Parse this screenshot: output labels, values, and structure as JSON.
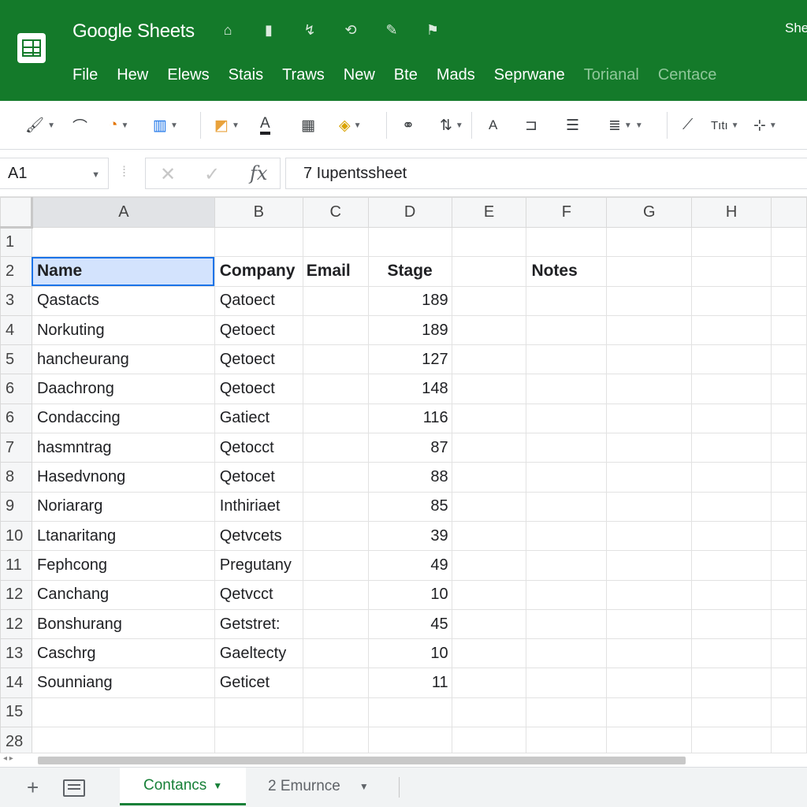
{
  "app": {
    "title": "Google Sheets",
    "share_label": "She"
  },
  "menu": [
    "File",
    "Hew",
    "Elews",
    "Stais",
    "Traws",
    "New",
    "Bte",
    "Mads",
    "Seprwane",
    "Torianal",
    "Centace"
  ],
  "toolbar": {
    "text_button_label": "A",
    "font_size_label": "Tıtı"
  },
  "formula_bar": {
    "cell_ref": "A1",
    "content": "7 Iupentssheet"
  },
  "columns": [
    "A",
    "B",
    "C",
    "D",
    "E",
    "F",
    "G",
    "H"
  ],
  "header_row": {
    "row_num": "2",
    "name": "Name",
    "company": "Company",
    "email": "Email",
    "stage": "Stage",
    "notes": "Notes"
  },
  "rows": [
    {
      "row_num": "3",
      "name": "Qastacts",
      "company": "Qatoect",
      "stage": "189"
    },
    {
      "row_num": "4",
      "name": "Norkuting",
      "company": "Qetoect",
      "stage": "189"
    },
    {
      "row_num": "5",
      "name": "hancheurang",
      "company": "Qetoect",
      "stage": "127"
    },
    {
      "row_num": "6",
      "name": "Daachrong",
      "company": "Qetoect",
      "stage": "148"
    },
    {
      "row_num": "6",
      "name": "Condaccing",
      "company": "Gatiect",
      "stage": "116"
    },
    {
      "row_num": "7",
      "name": "hasmntrag",
      "company": "Qetocct",
      "stage": "87"
    },
    {
      "row_num": "8",
      "name": "Hasedvnong",
      "company": "Qetocet",
      "stage": "88"
    },
    {
      "row_num": "9",
      "name": "Noriararg",
      "company": "Inthiriaet",
      "stage": "85"
    },
    {
      "row_num": "10",
      "name": "Ltanaritang",
      "company": "Qetvcets",
      "stage": "39"
    },
    {
      "row_num": "11",
      "name": "Fephcong",
      "company": "Pregutany",
      "stage": "49"
    },
    {
      "row_num": "12",
      "name": "Canchang",
      "company": "Qetvcct",
      "stage": "10"
    },
    {
      "row_num": "12",
      "name": "Bonshurang",
      "company": "Getstret:",
      "stage": "45"
    },
    {
      "row_num": "13",
      "name": "Caschrg",
      "company": "Gaeltecty",
      "stage": "10"
    },
    {
      "row_num": "14",
      "name": "Sounniang",
      "company": "Geticet",
      "stage": "11"
    }
  ],
  "empty_rows": [
    "1",
    "15",
    "28"
  ],
  "sheets": [
    {
      "label": "Contancs",
      "active": true
    },
    {
      "label": "2 Emurnce",
      "active": false
    }
  ],
  "colors": {
    "header_green": "#147a2a",
    "active_tab": "#188038",
    "selection": "#d3e3fd",
    "selection_border": "#1a73e8"
  }
}
